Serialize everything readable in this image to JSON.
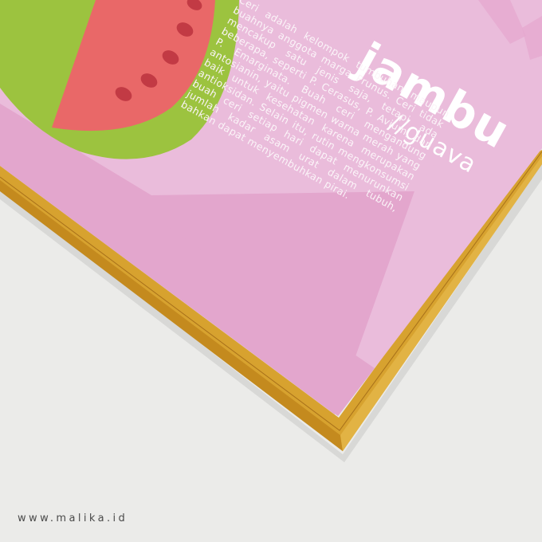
{
  "poster": {
    "title": "jambu",
    "subtitle": "//guava",
    "body": "Ceri adalah kelompok tumbuhan maupun buahnya anggota marga Prunus. Ceri tidak mencakup satu jenis saja, tetapi ada beberapa, seperti P. Cerasus, P. Avium, dan P. Emarginata. Buah ceri mengandung antosianin, yaitu pigmen warna merah yang baik untuk kesehatan karena merupakan antioksidan. Selain itu, rutin mengkonsumsi buah ceri setiap hari dapat menurunkan jumlah kadar asam urat dalam tubuh, bahkan dapat menyembuhkan pirai."
  },
  "watermark": "www.malika.id",
  "colors": {
    "background": "#ebebe9",
    "poster_pink": "#eabcdb",
    "poster_band": "#e3a6cd",
    "frame_wood": "#d7a22f",
    "fruit_rind": "#9cc33f",
    "fruit_flesh": "#e96868",
    "fruit_seed": "#c23a44"
  },
  "icons": [
    "fruit-slice-illustration"
  ]
}
